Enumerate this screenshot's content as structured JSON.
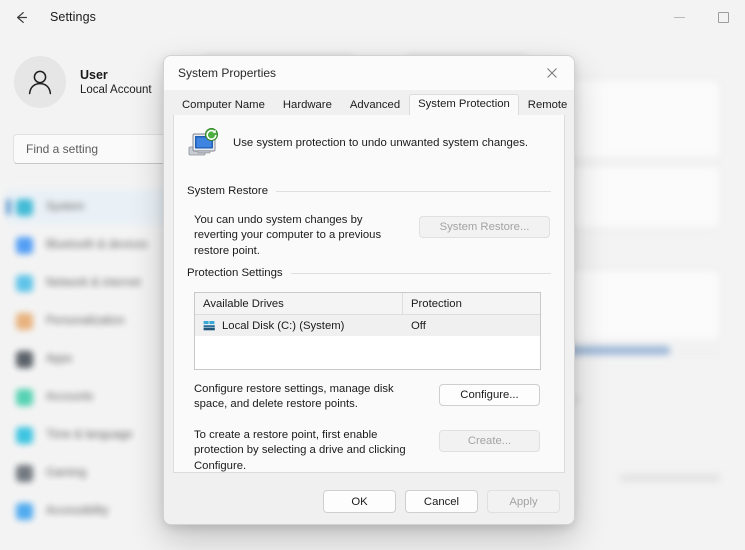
{
  "settings": {
    "titlebar": {
      "back_icon": "back-arrow-icon",
      "title": "Settings",
      "minimize_icon": "minimize-icon",
      "maximize_icon": "maximize-icon"
    },
    "account": {
      "avatar_icon": "person-avatar-icon",
      "name": "User",
      "subtitle": "Local Account"
    },
    "search": {
      "placeholder": "Find a setting",
      "value": ""
    },
    "nav": {
      "items": [
        {
          "label": "System",
          "icon": "system-icon",
          "color": "#3cb9d6",
          "active": true
        },
        {
          "label": "Bluetooth & devices",
          "icon": "bluetooth-devices-icon",
          "color": "#4c9bf5",
          "active": false
        },
        {
          "label": "Network & internet",
          "icon": "network-internet-icon",
          "color": "#59c2e8",
          "active": false
        },
        {
          "label": "Personalization",
          "icon": "personalization-icon",
          "color": "#e8b07a",
          "active": false
        },
        {
          "label": "Apps",
          "icon": "apps-icon",
          "color": "#555c63",
          "active": false
        },
        {
          "label": "Accounts",
          "icon": "accounts-icon",
          "color": "#4fd1b0",
          "active": false
        },
        {
          "label": "Time & language",
          "icon": "time-language-icon",
          "color": "#36c3e0",
          "active": false
        },
        {
          "label": "Gaming",
          "icon": "gaming-icon",
          "color": "#6e757c",
          "active": false
        },
        {
          "label": "Accessibility",
          "icon": "accessibility-icon",
          "color": "#4aa8ef",
          "active": false
        }
      ]
    }
  },
  "dialog": {
    "title": "System Properties",
    "close_icon": "close-icon",
    "tabs": [
      {
        "label": "Computer Name",
        "active": false
      },
      {
        "label": "Hardware",
        "active": false
      },
      {
        "label": "Advanced",
        "active": false
      },
      {
        "label": "System Protection",
        "active": true
      },
      {
        "label": "Remote",
        "active": false
      }
    ],
    "header": {
      "icon": "system-protection-computer-icon",
      "text": "Use system protection to undo unwanted system changes."
    },
    "system_restore": {
      "group_title": "System Restore",
      "description": "You can undo system changes by reverting your computer to a previous restore point.",
      "button_label": "System Restore...",
      "button_enabled": false
    },
    "protection_settings": {
      "group_title": "Protection Settings",
      "columns": [
        "Available Drives",
        "Protection"
      ],
      "rows": [
        {
          "drive": "Local Disk (C:) (System)",
          "drive_icon": "hard-drive-icon",
          "protection": "Off",
          "selected": true
        }
      ],
      "configure": {
        "description": "Configure restore settings, manage disk space, and delete restore points.",
        "button_label": "Configure...",
        "button_enabled": true
      },
      "create": {
        "description": "To create a restore point, first enable protection by selecting a drive and clicking Configure.",
        "button_label": "Create...",
        "button_enabled": false
      }
    },
    "footer": {
      "ok_label": "OK",
      "cancel_label": "Cancel",
      "apply_label": "Apply",
      "apply_enabled": false
    }
  }
}
